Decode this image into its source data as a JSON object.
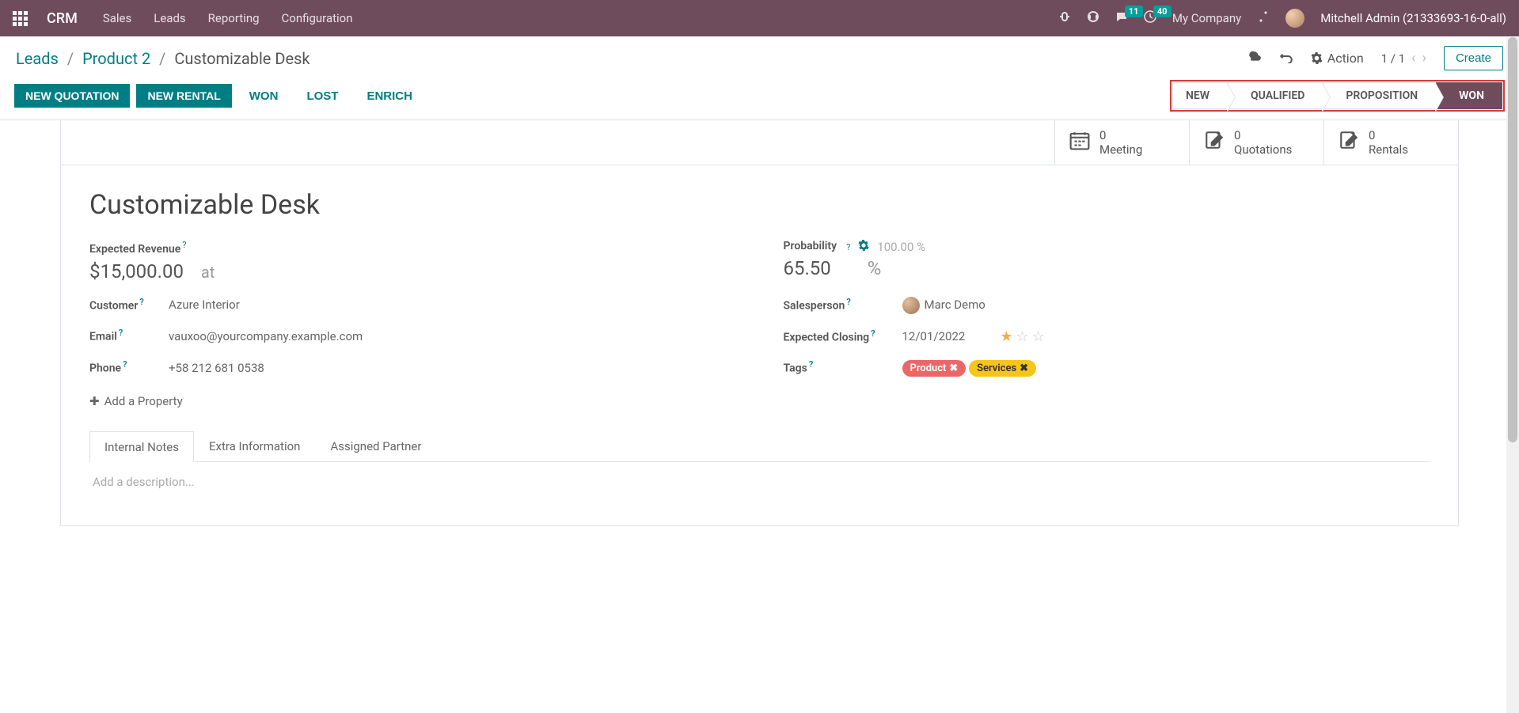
{
  "navbar": {
    "app_title": "CRM",
    "menu": [
      "Sales",
      "Leads",
      "Reporting",
      "Configuration"
    ],
    "messages_count": "11",
    "activities_count": "40",
    "company": "My Company",
    "user": "Mitchell Admin (21333693-16-0-all)"
  },
  "breadcrumb": {
    "items": [
      "Leads",
      "Product 2"
    ],
    "current": "Customizable Desk"
  },
  "controls": {
    "action_label": "Action",
    "pager": "1 / 1",
    "create_label": "Create"
  },
  "status_buttons": {
    "new_quotation": "NEW QUOTATION",
    "new_rental": "NEW RENTAL",
    "won": "WON",
    "lost": "LOST",
    "enrich": "ENRICH"
  },
  "stages": [
    "NEW",
    "QUALIFIED",
    "PROPOSITION",
    "WON"
  ],
  "stat_buttons": {
    "meeting": {
      "count": "0",
      "label": "Meeting"
    },
    "quotations": {
      "count": "0",
      "label": "Quotations"
    },
    "rentals": {
      "count": "0",
      "label": "Rentals"
    }
  },
  "lead": {
    "title": "Customizable Desk",
    "expected_revenue_label": "Expected Revenue",
    "expected_revenue": "$15,000.00",
    "at": "at",
    "probability_label": "Probability",
    "probability": "65.50",
    "probability_pct": "%",
    "auto_prob": "100.00 %",
    "customer_label": "Customer",
    "customer": "Azure Interior",
    "email_label": "Email",
    "email": "vauxoo@yourcompany.example.com",
    "phone_label": "Phone",
    "phone": "+58 212 681 0538",
    "salesperson_label": "Salesperson",
    "salesperson": "Marc Demo",
    "expected_closing_label": "Expected Closing",
    "expected_closing": "12/01/2022",
    "tags_label": "Tags",
    "tags": [
      {
        "name": "Product",
        "color": "red"
      },
      {
        "name": "Services",
        "color": "yellow"
      }
    ],
    "add_property": "Add a Property"
  },
  "tabs": {
    "items": [
      "Internal Notes",
      "Extra Information",
      "Assigned Partner"
    ],
    "description_placeholder": "Add a description..."
  }
}
